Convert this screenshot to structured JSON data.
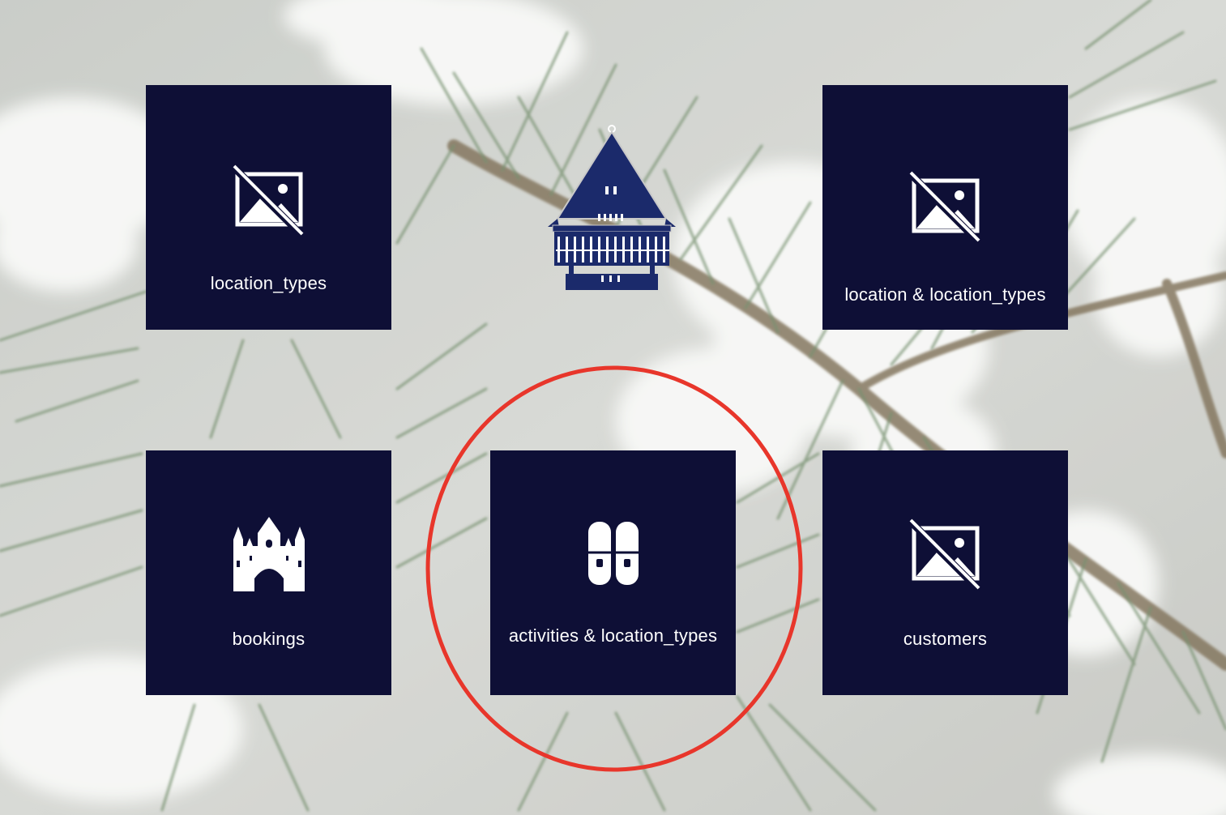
{
  "tiles": {
    "location_types": {
      "label": "location_types",
      "icon": "image-off-icon"
    },
    "location_and_types": {
      "label": "location & location_types",
      "icon": "image-off-icon"
    },
    "bookings": {
      "label": "bookings",
      "icon": "castle-icon"
    },
    "activities": {
      "label": "activities & location_types",
      "icon": "slippers-icon"
    },
    "customers": {
      "label": "customers",
      "icon": "image-off-icon"
    }
  },
  "logo": {
    "icon": "wooden-house-logo"
  },
  "colors": {
    "tile_bg": "#0e0f36",
    "tile_text": "#ffffff",
    "logo_blue": "#1b2a6b",
    "highlight": "#e8362b"
  }
}
